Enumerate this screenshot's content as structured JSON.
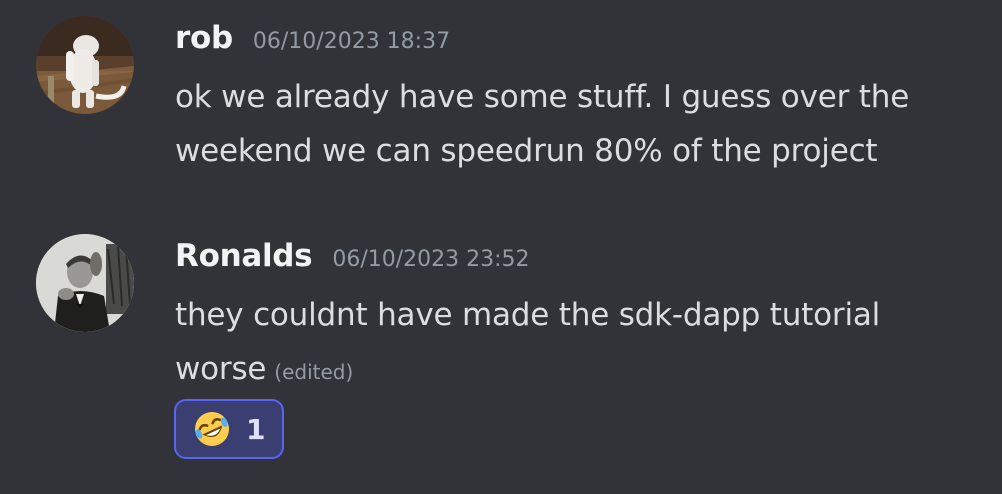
{
  "messages": [
    {
      "author": "rob",
      "timestamp": "06/10/2023 18:37",
      "lines": [
        "ok we already have some stuff. I guess over the",
        "weekend we can speedrun 80% of the project"
      ]
    },
    {
      "author": "Ronalds",
      "timestamp": "06/10/2023 23:52",
      "lines": [
        "they couldnt have made the sdk-dapp tutorial",
        "worse"
      ],
      "edited_label": "(edited)",
      "reaction": {
        "emoji": "rolling-on-floor-laughing-emoji",
        "count": "1"
      }
    }
  ],
  "colors": {
    "background": "#313338",
    "username": "#f2f3f5",
    "text": "#dbdee1",
    "muted": "#949ba4",
    "reaction_border": "#5865f2",
    "reaction_bg": "#3b3e70"
  }
}
